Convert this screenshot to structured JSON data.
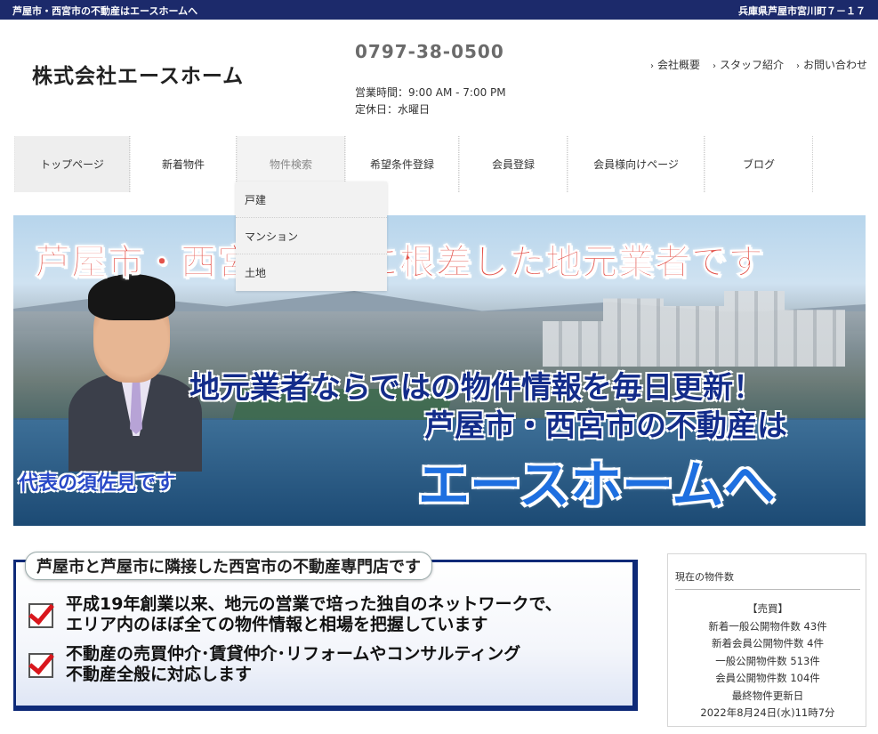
{
  "topbar": {
    "left": "芦屋市・西宮市の不動産はエースホームへ",
    "right": "兵庫県芦屋市宮川町７－１７"
  },
  "header": {
    "logo": "株式会社エースホーム",
    "phone": "0797-38-0500",
    "hours": "営業時間：9:00 AM - 7:00 PM",
    "closed": "定休日：水曜日",
    "links": [
      {
        "label": "会社概要"
      },
      {
        "label": "スタッフ紹介"
      },
      {
        "label": "お問い合わせ"
      }
    ],
    "link_icon": "chevron-right-icon"
  },
  "nav": {
    "items": [
      {
        "label": "トップページ"
      },
      {
        "label": "新着物件"
      },
      {
        "label": "物件検索"
      },
      {
        "label": "希望条件登録"
      },
      {
        "label": "会員登録"
      },
      {
        "label": "会員様向けページ"
      },
      {
        "label": "ブログ"
      }
    ],
    "dropdown": [
      {
        "label": "戸建"
      },
      {
        "label": "マンション"
      },
      {
        "label": "土地"
      }
    ]
  },
  "hero": {
    "line1": "芦屋市・西宮市地域に根差した地元業者です",
    "line2": "地元業者ならではの物件情報を毎日更新！",
    "line3": "芦屋市・西宮市の不動産は",
    "line4": "エースホームへ",
    "caption": "代表の須佐見です"
  },
  "info": {
    "title": "芦屋市と芦屋市に隣接した西宮市の不動産専門店です",
    "items": [
      {
        "line1": "平成19年創業以来、地元の営業で培った独自のネットワークで、",
        "line2": "エリア内のほぼ全ての物件情報と相場を把握しています"
      },
      {
        "line1": "不動産の売買仲介･賃貸仲介･リフォームやコンサルティング",
        "line2": "不動産全般に対応します"
      }
    ]
  },
  "listings": {
    "heading": "現在の物件数",
    "category": "【売買】",
    "new_public": "新着一般公開物件数 43件",
    "new_member": "新着会員公開物件数 4件",
    "public": "一般公開物件数 513件",
    "member": "会員公開物件数 104件",
    "updated_label": "最終物件更新日",
    "updated": "2022年8月24日(水)11時7分"
  },
  "colors": {
    "topbar": "#1c2a6b",
    "accent_blue": "#1e6fe0",
    "headline_red": "#e3524a",
    "check_red": "#d9161c",
    "frame_navy": "#0e2a78"
  }
}
